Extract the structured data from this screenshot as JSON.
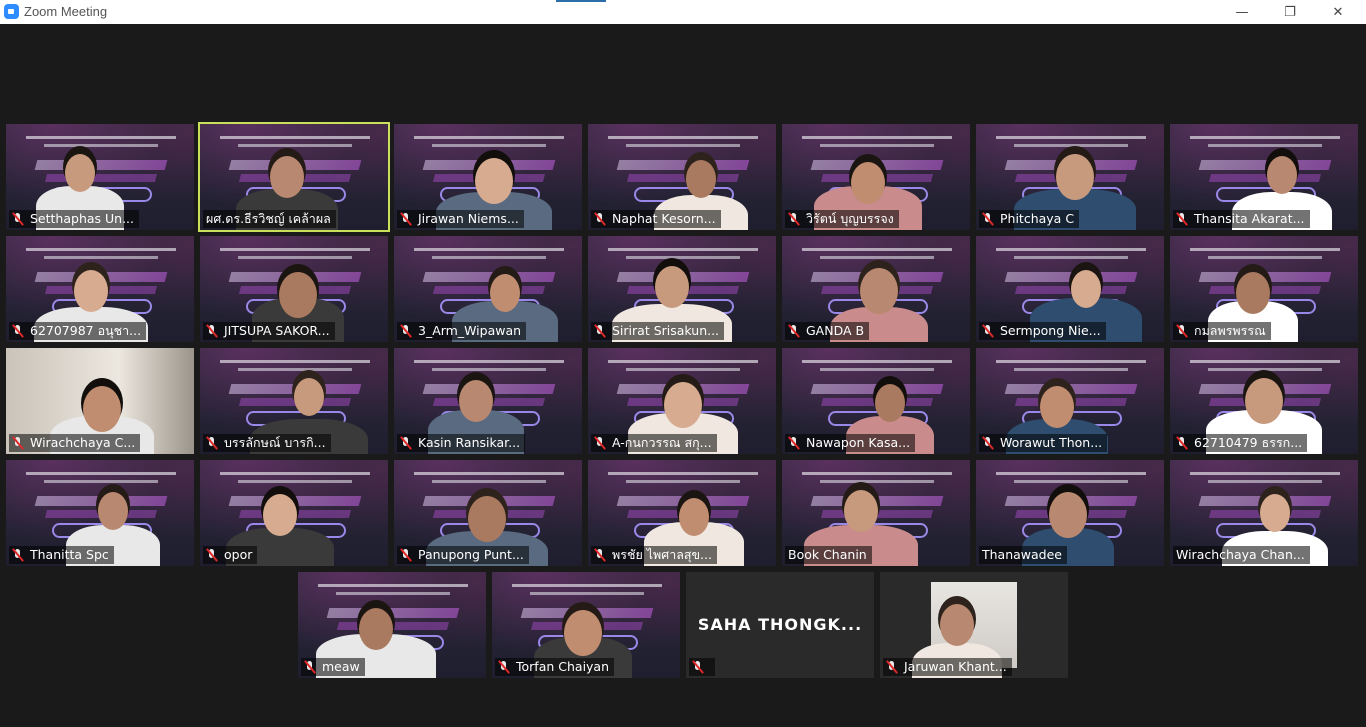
{
  "window": {
    "title": "Zoom Meeting",
    "minimize": "—",
    "maximize": "❐",
    "close": "✕"
  },
  "participants": [
    {
      "name": "Setthaphas Un...",
      "muted": true
    },
    {
      "name": "ผศ.ดร.ธีรวิชญ์ เคล้าผล",
      "muted": false,
      "active_speaker": true
    },
    {
      "name": "Jirawan Niems...",
      "muted": true
    },
    {
      "name": "Naphat Kesorn...",
      "muted": true
    },
    {
      "name": "วิรัตน์ บุญบรรจง",
      "muted": true
    },
    {
      "name": "Phitchaya C",
      "muted": true
    },
    {
      "name": "Thansita Akarat...",
      "muted": true
    },
    {
      "name": "62707987 อนุชา...",
      "muted": true
    },
    {
      "name": "JITSUPA SAKOR...",
      "muted": true
    },
    {
      "name": "3_Arm_Wipawan",
      "muted": true
    },
    {
      "name": "Sirirat Srisakun...",
      "muted": true
    },
    {
      "name": "GANDA B",
      "muted": true
    },
    {
      "name": "Sermpong Nie...",
      "muted": true
    },
    {
      "name": "กมลพรพรรณ",
      "muted": true
    },
    {
      "name": "Wirachchaya C...",
      "muted": true
    },
    {
      "name": "บรรลักษณ์ บารกิ...",
      "muted": true
    },
    {
      "name": "Kasin Ransikar...",
      "muted": true
    },
    {
      "name": "A-กนกวรรณ สกุ...",
      "muted": true
    },
    {
      "name": "Nawapon Kasa...",
      "muted": true
    },
    {
      "name": "Worawut Thon...",
      "muted": true
    },
    {
      "name": "62710479 ธรรก...",
      "muted": true
    },
    {
      "name": "Thanitta Spc",
      "muted": true
    },
    {
      "name": "opor",
      "muted": true
    },
    {
      "name": "Panupong Punt...",
      "muted": true
    },
    {
      "name": "พรชัย ไพศาลสุข...",
      "muted": true
    },
    {
      "name": "Book Chanin",
      "muted": false
    },
    {
      "name": "Thanawadee",
      "muted": false
    },
    {
      "name": "Wirachchaya Chan...",
      "muted": false
    },
    {
      "name": "meaw",
      "muted": true
    },
    {
      "name": "Torfan Chaiyan",
      "muted": true
    },
    {
      "name": "",
      "display_text": "SAHA  THONGK...",
      "muted": true
    },
    {
      "name": "Jaruwan Khant...",
      "muted": true
    }
  ]
}
